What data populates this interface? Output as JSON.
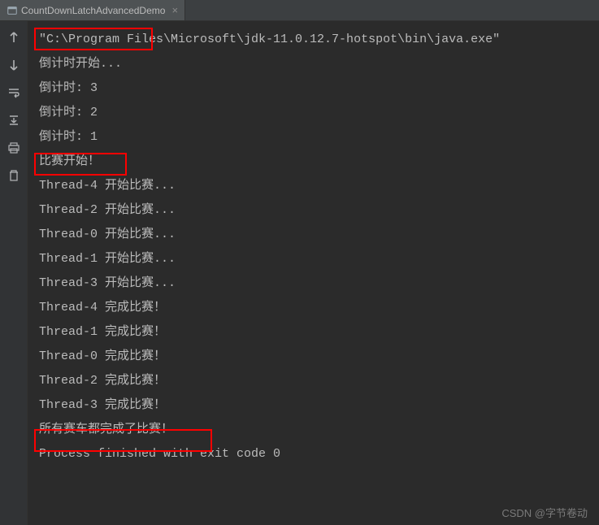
{
  "tab": {
    "label": "CountDownLatchAdvancedDemo",
    "close": "×"
  },
  "gutter": {
    "icons": [
      "arrow-up",
      "arrow-down",
      "wrap",
      "scroll-down",
      "print",
      "trash"
    ]
  },
  "console": {
    "lines": [
      "\"C:\\Program Files\\Microsoft\\jdk-11.0.12.7-hotspot\\bin\\java.exe\"",
      "倒计时开始...",
      "倒计时: 3",
      "倒计时: 2",
      "倒计时: 1",
      "比赛开始！",
      "Thread-4 开始比赛...",
      "Thread-2 开始比赛...",
      "Thread-0 开始比赛...",
      "Thread-1 开始比赛...",
      "Thread-3 开始比赛...",
      "Thread-4 完成比赛！",
      "Thread-1 完成比赛！",
      "Thread-0 完成比赛！",
      "Thread-2 完成比赛！",
      "Thread-3 完成比赛！",
      "所有赛车都完成了比赛！",
      "",
      "Process finished with exit code 0"
    ]
  },
  "watermark": "CSDN @字节卷动"
}
